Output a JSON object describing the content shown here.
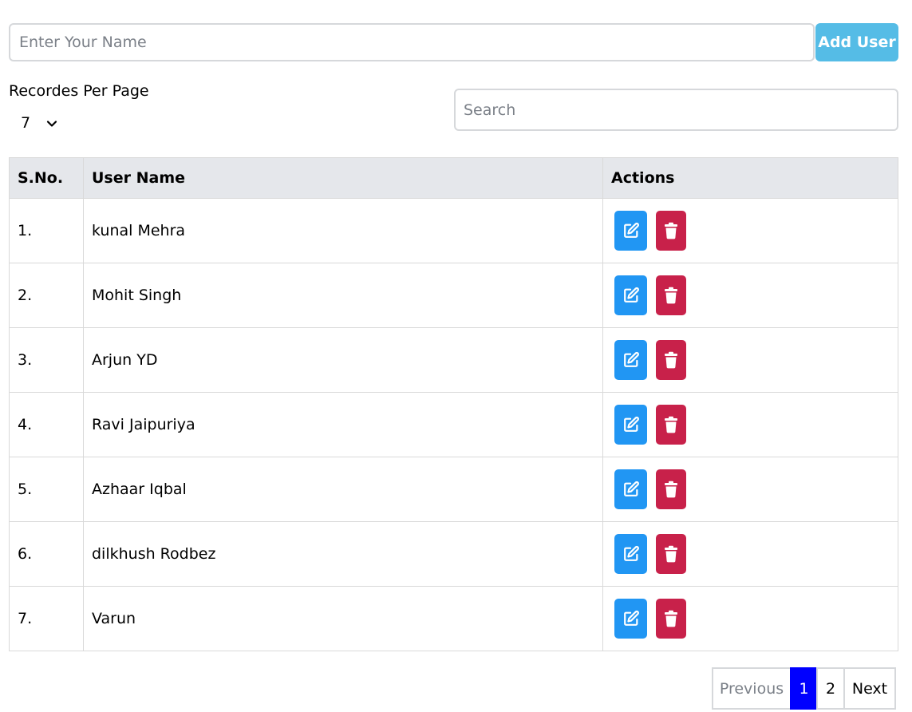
{
  "form": {
    "name_placeholder": "Enter Your Name",
    "name_value": "",
    "add_label": "Add User"
  },
  "records_per_page": {
    "label": "Recordes Per Page",
    "selected": "7"
  },
  "search": {
    "placeholder": "Search",
    "value": ""
  },
  "table": {
    "headers": {
      "sno": "S.No.",
      "name": "User Name",
      "actions": "Actions"
    },
    "rows": [
      {
        "sno": "1.",
        "name": "kunal Mehra"
      },
      {
        "sno": "2.",
        "name": "Mohit Singh"
      },
      {
        "sno": "3.",
        "name": "Arjun YD"
      },
      {
        "sno": "4.",
        "name": "Ravi Jaipuriya"
      },
      {
        "sno": "5.",
        "name": "Azhaar Iqbal"
      },
      {
        "sno": "6.",
        "name": "dilkhush Rodbez"
      },
      {
        "sno": "7.",
        "name": "Varun"
      }
    ],
    "edit_icon": "edit-icon",
    "delete_icon": "trash-icon"
  },
  "pagination": {
    "previous": "Previous",
    "pages": [
      "1",
      "2"
    ],
    "current": "1",
    "next": "Next"
  },
  "colors": {
    "add_button": "#55bce6",
    "edit_button": "#2196f3",
    "delete_button": "#c8214a",
    "active_page": "#0000ff",
    "header_bg": "#e5e7eb"
  }
}
